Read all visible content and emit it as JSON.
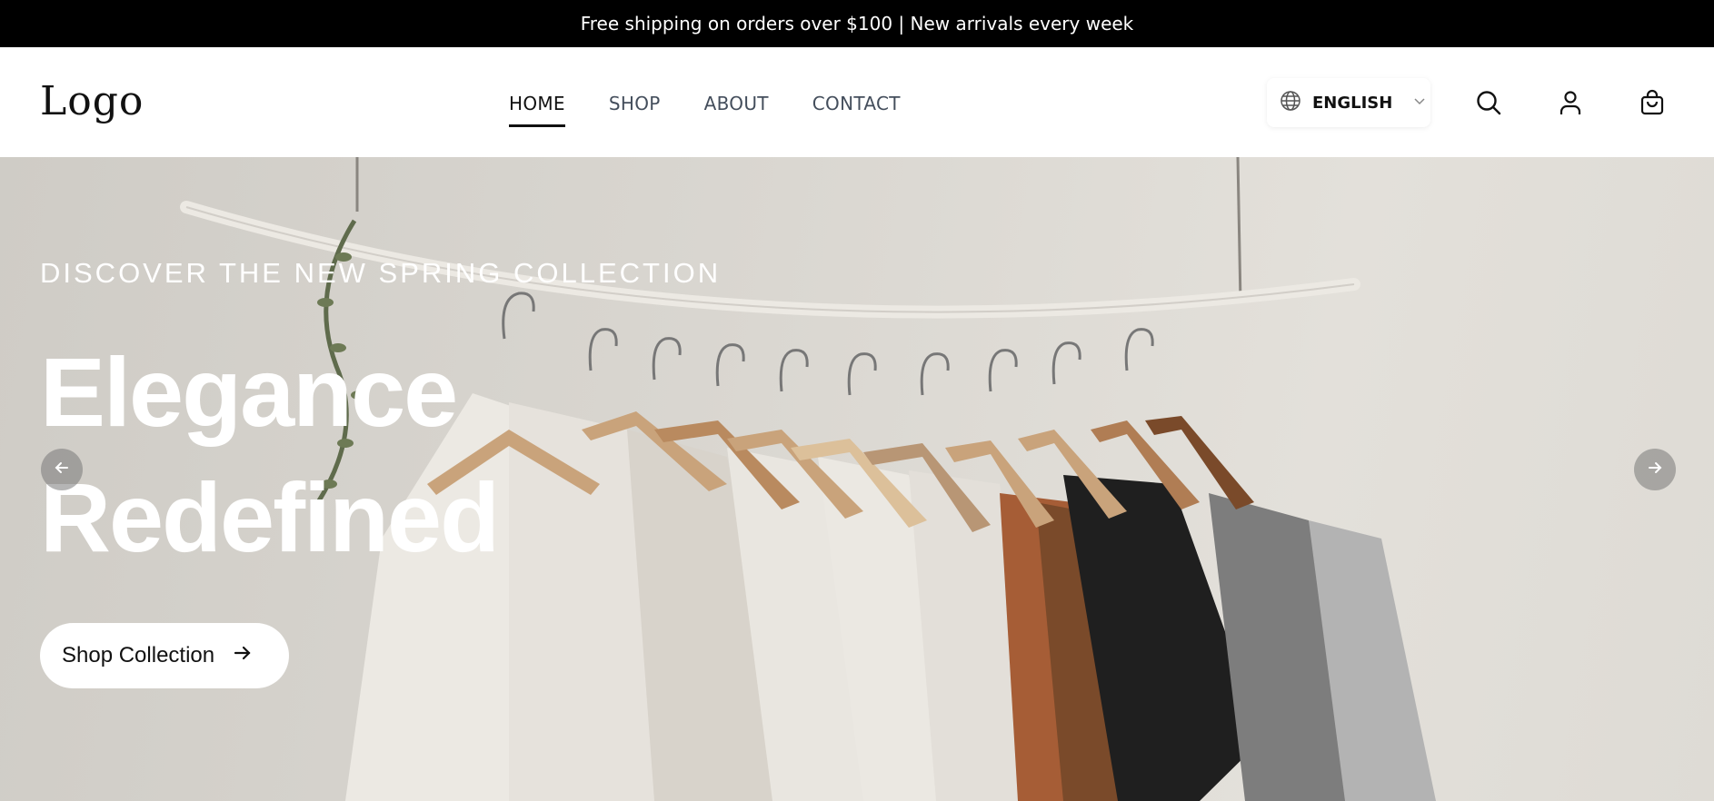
{
  "announcement": "Free shipping on orders over $100 | New arrivals every week",
  "header": {
    "logo": "Logo",
    "nav": [
      {
        "label": "HOME",
        "active": true
      },
      {
        "label": "SHOP",
        "active": false
      },
      {
        "label": "ABOUT",
        "active": false
      },
      {
        "label": "CONTACT",
        "active": false
      }
    ],
    "language": "ENGLISH",
    "icons": [
      "globe-icon",
      "chevron-down-icon",
      "search-icon",
      "user-icon",
      "shopping-bag-icon"
    ]
  },
  "hero": {
    "eyebrow": "DISCOVER THE NEW SPRING COLLECTION",
    "title_line1": "Elegance",
    "title_line2": "Redefined",
    "cta_label": "Shop Collection",
    "icons": [
      "arrow-right-icon",
      "arrow-left-icon"
    ]
  },
  "colors": {
    "announcement_bg": "#000000",
    "text_dark": "#111111",
    "nav_inactive": "#444e5c",
    "hero_bg": "#d9d6d0"
  }
}
